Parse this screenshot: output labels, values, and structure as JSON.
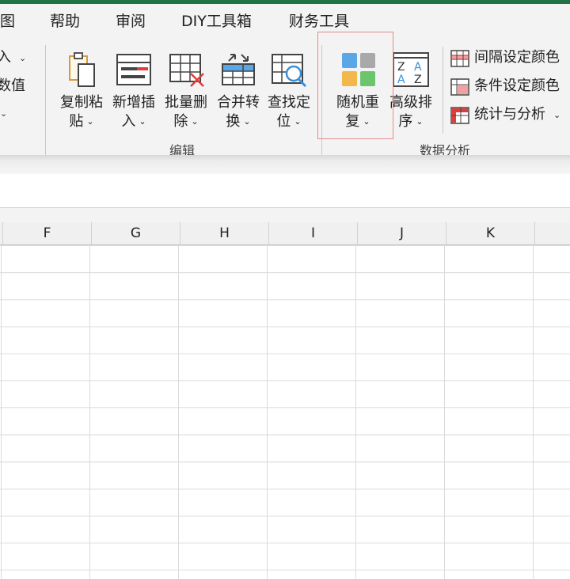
{
  "menu": {
    "tabs": [
      "图",
      "帮助",
      "审阅",
      "DIY工具箱",
      "财务工具"
    ]
  },
  "ribbon": {
    "left_partial": {
      "row1": "入",
      "row2": "数值"
    },
    "edit_group": {
      "label": "编辑",
      "buttons": [
        {
          "line1": "复制粘",
          "line2": "贴"
        },
        {
          "line1": "新增插",
          "line2": "入"
        },
        {
          "line1": "批量删",
          "line2": "除"
        },
        {
          "line1": "合并转",
          "line2": "换"
        },
        {
          "line1": "查找定",
          "line2": "位"
        }
      ]
    },
    "data_group": {
      "label": "数据分析",
      "random_repeat": {
        "line1": "随机重",
        "line2": "复"
      },
      "advanced_sort": {
        "line1": "高级排",
        "line2": "序"
      },
      "small_buttons": [
        {
          "label": "间隔设定颜色",
          "has_dropdown": false
        },
        {
          "label": "条件设定颜色",
          "has_dropdown": false
        },
        {
          "label": "统计与分析",
          "has_dropdown": true
        }
      ]
    }
  },
  "sheet": {
    "columns": [
      "F",
      "G",
      "H",
      "I",
      "J",
      "K"
    ]
  },
  "colors": {
    "accent_green": "#217346",
    "highlight_red": "#e58a8a",
    "icon_blue": "#5aa6e6",
    "icon_orange": "#f2b84b",
    "icon_green": "#6cc56c",
    "icon_gray": "#a9a9a9",
    "icon_red": "#e03c3c"
  }
}
